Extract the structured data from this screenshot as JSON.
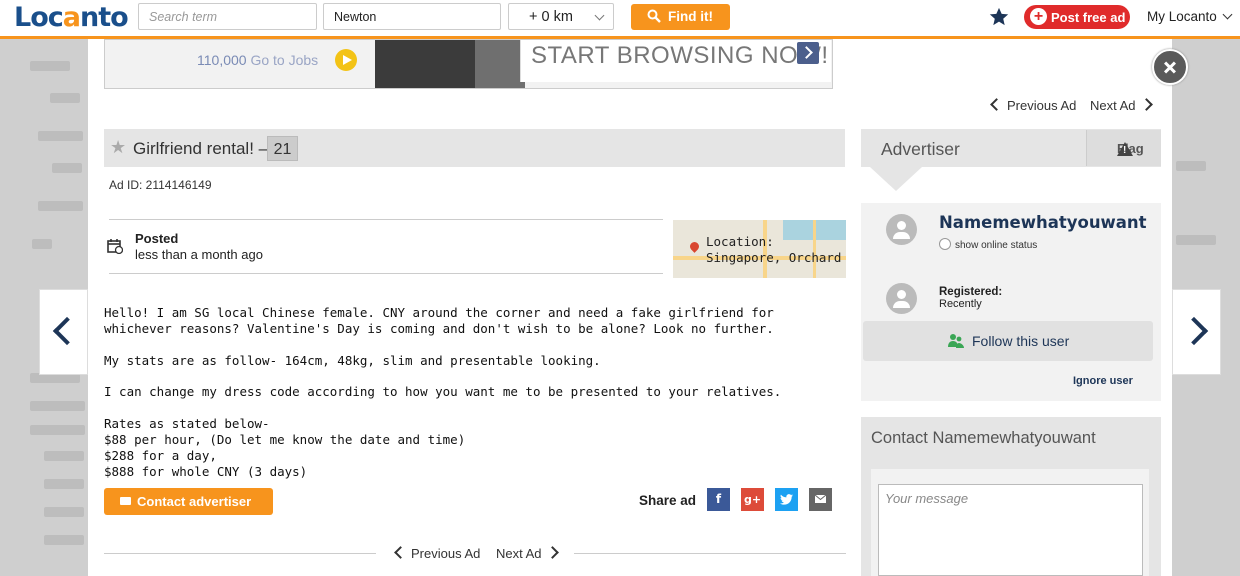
{
  "header": {
    "logo_text": "Locanto",
    "search_placeholder": "Search term",
    "location_value": "Newton",
    "radius_value": "+ 0 km",
    "find_button": "Find it!",
    "post_button": "Post free ad",
    "account_menu": "My Locanto"
  },
  "banner": {
    "jobs_count": "110,000",
    "jobs_link": "Go to Jobs",
    "browse_text": "START BROWSING NOW!"
  },
  "nav": {
    "previous_ad": "Previous Ad",
    "next_ad": "Next Ad"
  },
  "ad": {
    "title": "Girlfriend rental! –",
    "age": "21",
    "ad_id": "Ad ID: 2114146149",
    "posted_label": "Posted",
    "posted_value": "less than a month ago",
    "location_label": "Location:",
    "location_value": "Singapore, Orchard",
    "description": [
      "Hello! I am SG local Chinese female. CNY around the corner and need a fake girlfriend for whichever reasons? Valentine's Day is coming and don't wish to be alone? Look no further.",
      "My stats are as follow- 164cm, 48kg, slim and presentable looking.",
      "I can change my dress code according to how you want me to be presented to your relatives."
    ],
    "rates": [
      "Rates as stated below-",
      "$88 per hour, (Do let me know the date and time)",
      "$288 for a day,",
      "$888 for whole CNY (3 days)"
    ],
    "contact_button": "Contact advertiser",
    "share_label": "Share ad",
    "share_icons": [
      "f",
      "g+",
      "twitter-bird",
      "mail"
    ]
  },
  "advertiser": {
    "heading": "Advertiser",
    "flag_label": "Flag",
    "username": "Namemewhatyouwant",
    "online_status": "show online status",
    "registered_label": "Registered:",
    "registered_value": "Recently",
    "follow_button": "Follow this user",
    "ignore_link": "Ignore user",
    "contact_heading": "Contact Namemewhatyouwant",
    "message_placeholder": "Your message"
  },
  "colors": {
    "brand_orange": "#f7941d",
    "brand_navy": "#1d3557",
    "post_red": "#e02b2b",
    "facebook": "#3b5998",
    "google": "#dd4b39",
    "twitter": "#1da1f2",
    "mail": "#666666"
  }
}
